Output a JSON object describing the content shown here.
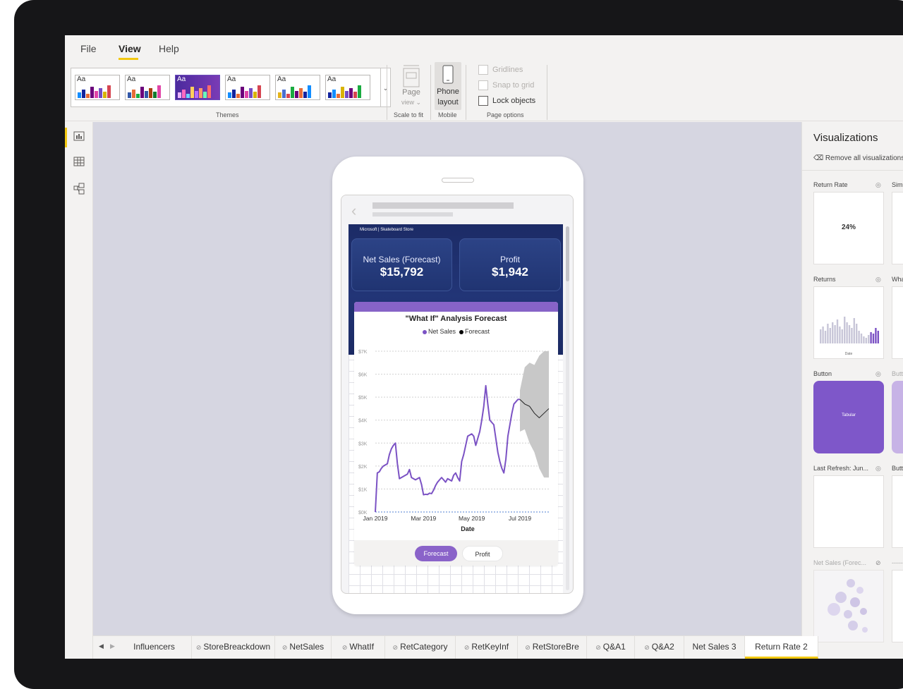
{
  "menu": {
    "file": "File",
    "view": "View",
    "help": "Help"
  },
  "ribbon": {
    "themes_label": "Themes",
    "theme_aa": "Aa",
    "page_view": "Page",
    "page_view_sub": "view ⌄",
    "scale_label": "Scale to fit",
    "phone_layout_1": "Phone",
    "phone_layout_2": "layout",
    "mobile_label": "Mobile",
    "gridlines": "Gridlines",
    "snap_to_grid": "Snap to grid",
    "lock_objects": "Lock objects",
    "page_options_label": "Page options"
  },
  "report": {
    "brand": "Microsoft | Skateboard Store",
    "cards": [
      {
        "title": "Net Sales (Forecast)",
        "value": "$15,792"
      },
      {
        "title": "Profit",
        "value": "$1,942"
      }
    ],
    "buttons": {
      "forecast": "Forecast",
      "profit": "Profit"
    }
  },
  "chart_data": {
    "type": "line",
    "title": "\"What If\" Analysis Forecast",
    "legend": [
      "Net Sales",
      "Forecast"
    ],
    "xlabel": "Date",
    "ylabel": "",
    "ylim": [
      0,
      7000
    ],
    "y_ticks": [
      "$0K",
      "$1K",
      "$2K",
      "$3K",
      "$4K",
      "$5K",
      "$6K",
      "$7K"
    ],
    "x_ticks": [
      "Jan 2019",
      "Mar 2019",
      "May 2019",
      "Jul 2019"
    ],
    "grid": true,
    "colors": {
      "net_sales": "#7b52c4",
      "forecast": "#222222",
      "band": "#c8c8c8"
    },
    "series": [
      {
        "name": "Net Sales",
        "x": [
          0,
          0.0833,
          0.1667,
          0.25,
          0.3333,
          0.4167,
          0.5,
          0.5833,
          0.6667,
          0.75,
          0.8333,
          0.9167,
          1.0,
          1.0833,
          1.1667,
          1.25,
          1.3333,
          1.4167,
          1.5,
          1.5833,
          1.6667,
          1.75,
          1.8333,
          1.9167,
          2.0,
          2.0833,
          2.1667,
          2.25,
          2.3333,
          2.4167,
          2.5,
          2.5833,
          2.6667,
          2.75,
          2.8333,
          2.9167,
          3.0,
          3.0833,
          3.1667,
          3.25,
          3.3333,
          3.4167,
          3.5,
          3.5833,
          3.6667,
          3.75,
          3.8333,
          3.9167,
          4.0,
          4.0833,
          4.1667,
          4.25,
          4.3333,
          4.4167,
          4.5,
          4.5833,
          4.6667,
          4.75,
          4.8333,
          4.9167,
          5.0,
          5.0833,
          5.1667,
          5.25,
          5.3333,
          5.4167,
          5.5,
          5.5833,
          5.6667,
          5.75,
          5.8333,
          5.9167,
          6.0
        ],
        "values": [
          0,
          1700,
          1750,
          1900,
          2000,
          2050,
          2100,
          2500,
          2750,
          2900,
          3000,
          2100,
          1450,
          1500,
          1550,
          1600,
          1650,
          1850,
          1500,
          1450,
          1400,
          1450,
          1500,
          1200,
          750,
          770,
          760,
          820,
          800,
          950,
          1150,
          1300,
          1400,
          1500,
          1400,
          1300,
          1450,
          1400,
          1350,
          1600,
          1700,
          1500,
          1350,
          2200,
          2500,
          2900,
          3300,
          3350,
          3400,
          3300,
          2900,
          3200,
          3500,
          4000,
          4600,
          5500,
          4700,
          4000,
          3900,
          3800,
          3200,
          2600,
          2200,
          1900,
          1700,
          2300,
          3300,
          3800,
          4300,
          4700,
          4800,
          4900,
          4900
        ]
      },
      {
        "name": "Forecast",
        "x": [
          6.0,
          6.2,
          6.4,
          6.6,
          6.8,
          7.0,
          7.2
        ],
        "values": [
          4900,
          4700,
          4600,
          4300,
          4100,
          4300,
          4500
        ],
        "band_upper": [
          5300,
          6300,
          6500,
          6400,
          6800,
          7000,
          7000
        ],
        "band_lower": [
          3500,
          3600,
          3000,
          2600,
          1900,
          1500,
          1500
        ]
      }
    ]
  },
  "viz": {
    "title": "Visualizations",
    "remove_all": "Remove all visualizations",
    "items": [
      {
        "label": "Return Rate",
        "value": "24%"
      },
      {
        "label": "Simple I"
      },
      {
        "label": "Returns",
        "xlabel": "Date"
      },
      {
        "label": "What If..."
      },
      {
        "label": "Button",
        "text": "Tabular"
      },
      {
        "label": "Button"
      },
      {
        "label": "Last Refresh: Jun..."
      },
      {
        "label": "Button"
      },
      {
        "label": "Net Sales (Forec..."
      },
      {
        "label": "---------B"
      }
    ]
  },
  "tabs": [
    {
      "label": "Influencers",
      "hidden": false
    },
    {
      "label": "StoreBreackdown",
      "hidden": true
    },
    {
      "label": "NetSales",
      "hidden": true
    },
    {
      "label": "WhatIf",
      "hidden": true
    },
    {
      "label": "RetCategory",
      "hidden": true
    },
    {
      "label": "RetKeyInf",
      "hidden": true
    },
    {
      "label": "RetStoreBre",
      "hidden": true
    },
    {
      "label": "Q&A1",
      "hidden": true
    },
    {
      "label": "Q&A2",
      "hidden": true
    },
    {
      "label": "Net Sales 3",
      "hidden": false
    },
    {
      "label": "Return Rate 2",
      "hidden": false,
      "active": true
    }
  ]
}
